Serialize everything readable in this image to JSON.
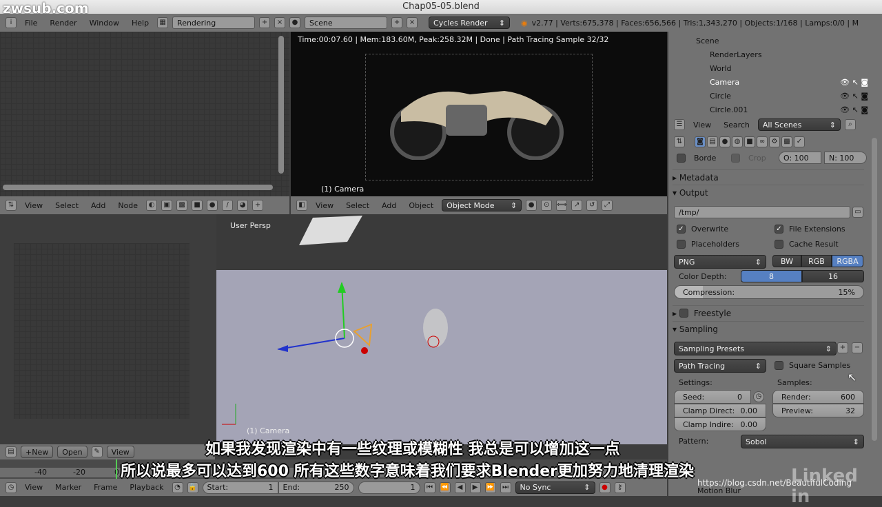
{
  "window": {
    "title": "Chap05-05.blend",
    "watermark": "zwsub.com"
  },
  "info_header": {
    "menus": [
      "File",
      "Render",
      "Window",
      "Help"
    ],
    "layout": "Rendering",
    "scene": "Scene",
    "engine": "Cycles Render",
    "stats": "v2.77 | Verts:675,378 | Faces:656,566 | Tris:1,343,270 | Objects:1/168 | Lamps:0/0 | M"
  },
  "render_view": {
    "status": "Time:00:07.60 | Mem:183.60M, Peak:258.32M | Done | Path Tracing Sample 32/32",
    "camera_label": "(1) Camera"
  },
  "node_header": {
    "menus": [
      "View",
      "Select",
      "Add",
      "Node"
    ]
  },
  "view3d_header": {
    "menus": [
      "View",
      "Select",
      "Add",
      "Object"
    ],
    "mode": "Object Mode"
  },
  "viewport": {
    "label": "User Persp",
    "camera_label": "(1) Camera"
  },
  "outliner": {
    "items": [
      {
        "name": "Scene"
      },
      {
        "name": "RenderLayers"
      },
      {
        "name": "World"
      },
      {
        "name": "Camera"
      },
      {
        "name": "Circle"
      },
      {
        "name": "Circle.001"
      }
    ],
    "menus": [
      "View",
      "Search"
    ],
    "filter": "All Scenes"
  },
  "properties": {
    "border": "Borde",
    "crop": "Crop",
    "o": "O: 100",
    "n": "N: 100",
    "metadata": "Metadata",
    "output": "Output",
    "path": "/tmp/",
    "overwrite": "Overwrite",
    "file_extensions": "File Extensions",
    "placeholders": "Placeholders",
    "cache_result": "Cache Result",
    "format": "PNG",
    "color_modes": [
      "BW",
      "RGB",
      "RGBA"
    ],
    "color_mode_selected": "RGBA",
    "color_depth_label": "Color Depth:",
    "depths": [
      "8",
      "16"
    ],
    "depth_selected": "8",
    "compression_label": "Compression:",
    "compression": "15%",
    "compression_value": 15,
    "freestyle": "Freestyle",
    "sampling": "Sampling",
    "presets": "Sampling Presets",
    "integrator": "Path Tracing",
    "square_samples": "Square Samples",
    "settings_label": "Settings:",
    "samples_label": "Samples:",
    "seed_label": "Seed:",
    "seed": "0",
    "clamp_direct_label": "Clamp Direct:",
    "clamp_direct": "0.00",
    "clamp_indirect_label": "Clamp Indire:",
    "clamp_indirect": "0.00",
    "render_label": "Render:",
    "render": "600",
    "preview_label": "Preview:",
    "preview": "32",
    "pattern_label": "Pattern:",
    "pattern": "Sobol",
    "motion_blur": "Motion Blur"
  },
  "image_header": {
    "new": "New",
    "open": "Open",
    "view": "View"
  },
  "timeline": {
    "ticks": [
      "-40",
      "-20",
      "0"
    ],
    "menus": [
      "View",
      "Marker",
      "Frame",
      "Playback"
    ],
    "start_label": "Start:",
    "start": "1",
    "end_label": "End:",
    "end": "250",
    "current": "1",
    "sync": "No Sync"
  },
  "subtitles": [
    "如果我发现渲染中有一些纹理或模糊性 我总是可以增加这一点",
    "所以说最多可以达到600  所有这些数字意味着我们要求Blender更加努力地清理渲染"
  ],
  "overlay": {
    "brand": "Linked in",
    "url": "https://blog.csdn.net/BeautifulCoding"
  }
}
